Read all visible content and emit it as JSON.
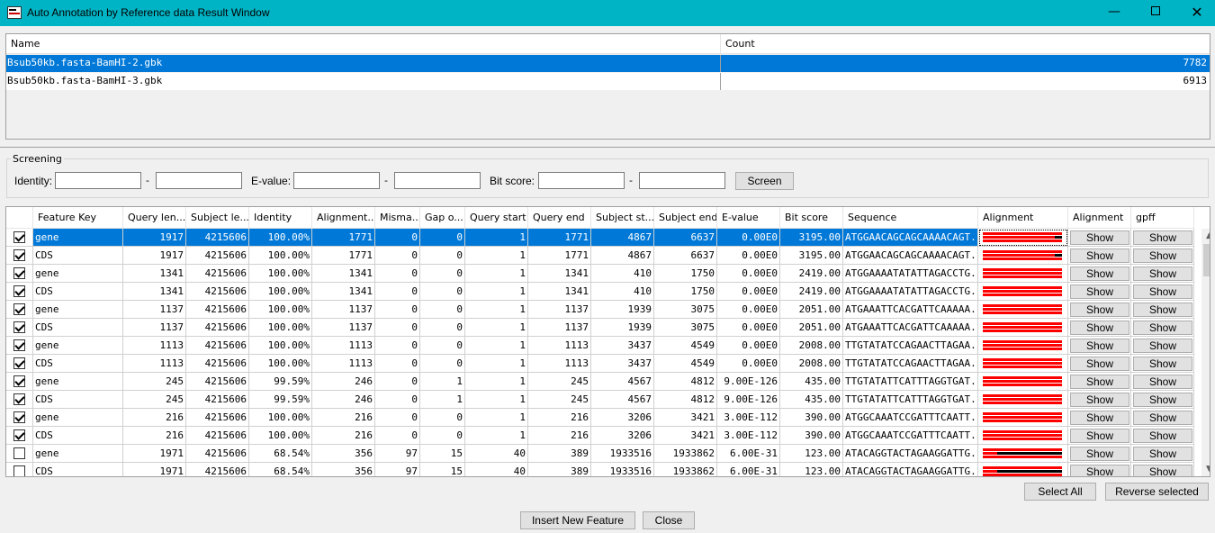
{
  "window": {
    "title": "Auto Annotation by Reference data Result Window",
    "minimize_glyph": "—",
    "close_glyph": "✕"
  },
  "filelist": {
    "headers": {
      "name": "Name",
      "count": "Count"
    },
    "rows": [
      {
        "name": "Bsub50kb.fasta-BamHI-2.gbk",
        "count": "7782",
        "selected": true
      },
      {
        "name": "Bsub50kb.fasta-BamHI-3.gbk",
        "count": "6913",
        "selected": false
      }
    ]
  },
  "screening": {
    "legend": "Screening",
    "identity_label": "Identity:",
    "evalue_label": "E-value:",
    "bitscore_label": "Bit score:",
    "dash": "-",
    "identity_from": "",
    "identity_to": "",
    "evalue_from": "",
    "evalue_to": "",
    "bitscore_from": "",
    "bitscore_to": "",
    "screen_button": "Screen"
  },
  "grid": {
    "headers": [
      "",
      "Feature Key",
      "Query len...",
      "Subject le...",
      "Identity",
      "Alignment...",
      "Misma...",
      "Gap o...",
      "Query start",
      "Query end",
      "Subject st...",
      "Subject end",
      "E-value",
      "Bit score",
      "Sequence",
      "Alignment",
      "Alignment",
      "gpff"
    ],
    "show_label": "Show",
    "rows": [
      {
        "checked": true,
        "key": "gene",
        "qlen": "1917",
        "slen": "4215606",
        "ident": "100.00%",
        "aln": "1771",
        "mis": "0",
        "gap": "0",
        "qs": "1",
        "qe": "1771",
        "ss": "4867",
        "se": "6637",
        "ev": "0.00E0",
        "bit": "3195.00",
        "seq": "ATGGAACAGCAGCAAAACAGT...",
        "bar": "partial"
      },
      {
        "checked": true,
        "key": "CDS",
        "qlen": "1917",
        "slen": "4215606",
        "ident": "100.00%",
        "aln": "1771",
        "mis": "0",
        "gap": "0",
        "qs": "1",
        "qe": "1771",
        "ss": "4867",
        "se": "6637",
        "ev": "0.00E0",
        "bit": "3195.00",
        "seq": "ATGGAACAGCAGCAAAACAGT...",
        "bar": "partial"
      },
      {
        "checked": true,
        "key": "gene",
        "qlen": "1341",
        "slen": "4215606",
        "ident": "100.00%",
        "aln": "1341",
        "mis": "0",
        "gap": "0",
        "qs": "1",
        "qe": "1341",
        "ss": "410",
        "se": "1750",
        "ev": "0.00E0",
        "bit": "2419.00",
        "seq": "ATGGAAAATATATTAGACCTG...",
        "bar": "full"
      },
      {
        "checked": true,
        "key": "CDS",
        "qlen": "1341",
        "slen": "4215606",
        "ident": "100.00%",
        "aln": "1341",
        "mis": "0",
        "gap": "0",
        "qs": "1",
        "qe": "1341",
        "ss": "410",
        "se": "1750",
        "ev": "0.00E0",
        "bit": "2419.00",
        "seq": "ATGGAAAATATATTAGACCTG...",
        "bar": "full"
      },
      {
        "checked": true,
        "key": "gene",
        "qlen": "1137",
        "slen": "4215606",
        "ident": "100.00%",
        "aln": "1137",
        "mis": "0",
        "gap": "0",
        "qs": "1",
        "qe": "1137",
        "ss": "1939",
        "se": "3075",
        "ev": "0.00E0",
        "bit": "2051.00",
        "seq": "ATGAAATTCACGATTCAAAAA...",
        "bar": "full"
      },
      {
        "checked": true,
        "key": "CDS",
        "qlen": "1137",
        "slen": "4215606",
        "ident": "100.00%",
        "aln": "1137",
        "mis": "0",
        "gap": "0",
        "qs": "1",
        "qe": "1137",
        "ss": "1939",
        "se": "3075",
        "ev": "0.00E0",
        "bit": "2051.00",
        "seq": "ATGAAATTCACGATTCAAAAA...",
        "bar": "full"
      },
      {
        "checked": true,
        "key": "gene",
        "qlen": "1113",
        "slen": "4215606",
        "ident": "100.00%",
        "aln": "1113",
        "mis": "0",
        "gap": "0",
        "qs": "1",
        "qe": "1113",
        "ss": "3437",
        "se": "4549",
        "ev": "0.00E0",
        "bit": "2008.00",
        "seq": "TTGTATATCCAGAACTTAGAA...",
        "bar": "full"
      },
      {
        "checked": true,
        "key": "CDS",
        "qlen": "1113",
        "slen": "4215606",
        "ident": "100.00%",
        "aln": "1113",
        "mis": "0",
        "gap": "0",
        "qs": "1",
        "qe": "1113",
        "ss": "3437",
        "se": "4549",
        "ev": "0.00E0",
        "bit": "2008.00",
        "seq": "TTGTATATCCAGAACTTAGAA...",
        "bar": "full"
      },
      {
        "checked": true,
        "key": "gene",
        "qlen": "245",
        "slen": "4215606",
        "ident": "99.59%",
        "aln": "246",
        "mis": "0",
        "gap": "1",
        "qs": "1",
        "qe": "245",
        "ss": "4567",
        "se": "4812",
        "ev": "9.00E-126",
        "bit": "435.00",
        "seq": "TTGTATATTCATTTAGGTGAT...",
        "bar": "full"
      },
      {
        "checked": true,
        "key": "CDS",
        "qlen": "245",
        "slen": "4215606",
        "ident": "99.59%",
        "aln": "246",
        "mis": "0",
        "gap": "1",
        "qs": "1",
        "qe": "245",
        "ss": "4567",
        "se": "4812",
        "ev": "9.00E-126",
        "bit": "435.00",
        "seq": "TTGTATATTCATTTAGGTGAT...",
        "bar": "full"
      },
      {
        "checked": true,
        "key": "gene",
        "qlen": "216",
        "slen": "4215606",
        "ident": "100.00%",
        "aln": "216",
        "mis": "0",
        "gap": "0",
        "qs": "1",
        "qe": "216",
        "ss": "3206",
        "se": "3421",
        "ev": "3.00E-112",
        "bit": "390.00",
        "seq": "ATGGCAAATCCGATTTCAATT...",
        "bar": "full"
      },
      {
        "checked": true,
        "key": "CDS",
        "qlen": "216",
        "slen": "4215606",
        "ident": "100.00%",
        "aln": "216",
        "mis": "0",
        "gap": "0",
        "qs": "1",
        "qe": "216",
        "ss": "3206",
        "se": "3421",
        "ev": "3.00E-112",
        "bit": "390.00",
        "seq": "ATGGCAAATCCGATTTCAATT...",
        "bar": "full"
      },
      {
        "checked": false,
        "key": "gene",
        "qlen": "1971",
        "slen": "4215606",
        "ident": "68.54%",
        "aln": "356",
        "mis": "97",
        "gap": "15",
        "qs": "40",
        "qe": "389",
        "ss": "1933516",
        "se": "1933862",
        "ev": "6.00E-31",
        "bit": "123.00",
        "seq": "ATACAGGTACTAGAAGGATTG...",
        "bar": "low"
      },
      {
        "checked": false,
        "key": "CDS",
        "qlen": "1971",
        "slen": "4215606",
        "ident": "68.54%",
        "aln": "356",
        "mis": "97",
        "gap": "15",
        "qs": "40",
        "qe": "389",
        "ss": "1933516",
        "se": "1933862",
        "ev": "6.00E-31",
        "bit": "123.00",
        "seq": "ATACAGGTACTAGAAGGATTG...",
        "bar": "low"
      }
    ]
  },
  "footer": {
    "select_all": "Select All",
    "reverse_selected": "Reverse selected",
    "insert_new_feature": "Insert New Feature",
    "close": "Close"
  },
  "colors": {
    "accent": "#00b4c5",
    "selection": "#0078d7",
    "match_red": "#ff0000",
    "mismatch_black": "#000000"
  }
}
